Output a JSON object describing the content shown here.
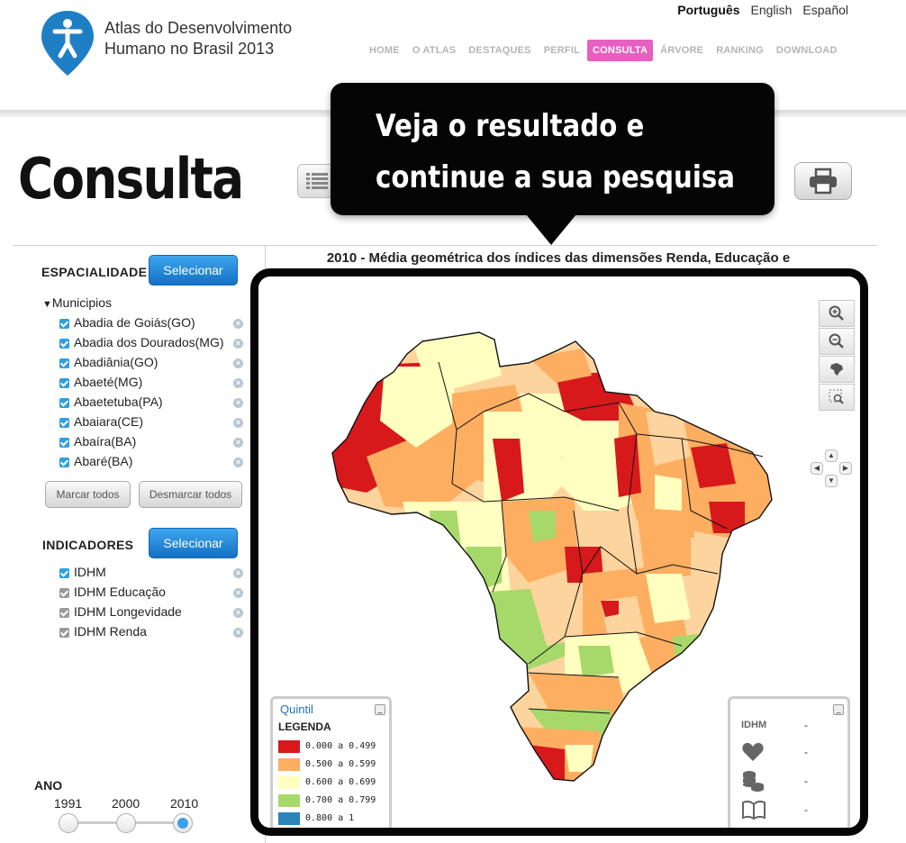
{
  "header": {
    "logo_line1": "Atlas do Desenvolvimento",
    "logo_line2": "Humano no Brasil 2013",
    "languages": [
      {
        "label": "Português",
        "active": true
      },
      {
        "label": "English",
        "active": false
      },
      {
        "label": "Español",
        "active": false
      }
    ],
    "nav": [
      {
        "label": "HOME",
        "active": false
      },
      {
        "label": "O ATLAS",
        "active": false
      },
      {
        "label": "DESTAQUES",
        "active": false
      },
      {
        "label": "PERFIL",
        "active": false
      },
      {
        "label": "CONSULTA",
        "active": true
      },
      {
        "label": "ÁRVORE",
        "active": false
      },
      {
        "label": "RANKING",
        "active": false
      },
      {
        "label": "DOWNLOAD",
        "active": false
      }
    ]
  },
  "page": {
    "title": "Consulta",
    "tooltip_line1": "Veja o resultado e",
    "tooltip_line2": "continue a sua pesquisa"
  },
  "espacialidade": {
    "title": "ESPACIALIDADE",
    "select_label": "Selecionar",
    "group_label": "Municipios",
    "items": [
      {
        "label": "Abadia de Goiás(GO)",
        "checked": true
      },
      {
        "label": "Abadia dos Dourados(MG)",
        "checked": true
      },
      {
        "label": "Abadiânia(GO)",
        "checked": true
      },
      {
        "label": "Abaeté(MG)",
        "checked": true
      },
      {
        "label": "Abaetetuba(PA)",
        "checked": true
      },
      {
        "label": "Abaiara(CE)",
        "checked": true
      },
      {
        "label": "Abaíra(BA)",
        "checked": true
      },
      {
        "label": "Abaré(BA)",
        "checked": true
      }
    ],
    "mark_all_label": "Marcar todos",
    "unmark_all_label": "Desmarcar todos"
  },
  "indicadores": {
    "title": "INDICADORES",
    "select_label": "Selecionar",
    "items": [
      {
        "label": "IDHM",
        "checked": true
      },
      {
        "label": "IDHM Educação",
        "checked": false
      },
      {
        "label": "IDHM Longevidade",
        "checked": false
      },
      {
        "label": "IDHM Renda",
        "checked": false
      }
    ]
  },
  "ano": {
    "title": "ANO",
    "years": [
      "1991",
      "2000",
      "2010"
    ],
    "selected": "2010"
  },
  "map": {
    "title": "2010 - Média geométrica dos índices das dimensões Renda, Educação e",
    "legend_title": "Quintil",
    "legend_subtitle": "LEGENDA",
    "legend": [
      {
        "label": "0.000 a 0.499",
        "color": "#d7191c"
      },
      {
        "label": "0.500 a 0.599",
        "color": "#fdae61"
      },
      {
        "label": "0.600 a 0.699",
        "color": "#ffffbf"
      },
      {
        "label": "0.700 a 0.799",
        "color": "#a6d96a"
      },
      {
        "label": "0.800 a 1",
        "color": "#2b83ba"
      }
    ],
    "info": [
      {
        "icon": "idhm-label",
        "label": "IDHM",
        "value": "-"
      },
      {
        "icon": "heart-icon",
        "label": "",
        "value": "-"
      },
      {
        "icon": "coins-icon",
        "label": "",
        "value": "-"
      },
      {
        "icon": "book-icon",
        "label": "",
        "value": "-"
      }
    ]
  },
  "colors": {
    "nav_active": "#e85fc2",
    "logo_blue": "#1f7fc4",
    "button_blue": "#1a7cd3",
    "checkbox_blue": "#2e9fe2"
  }
}
